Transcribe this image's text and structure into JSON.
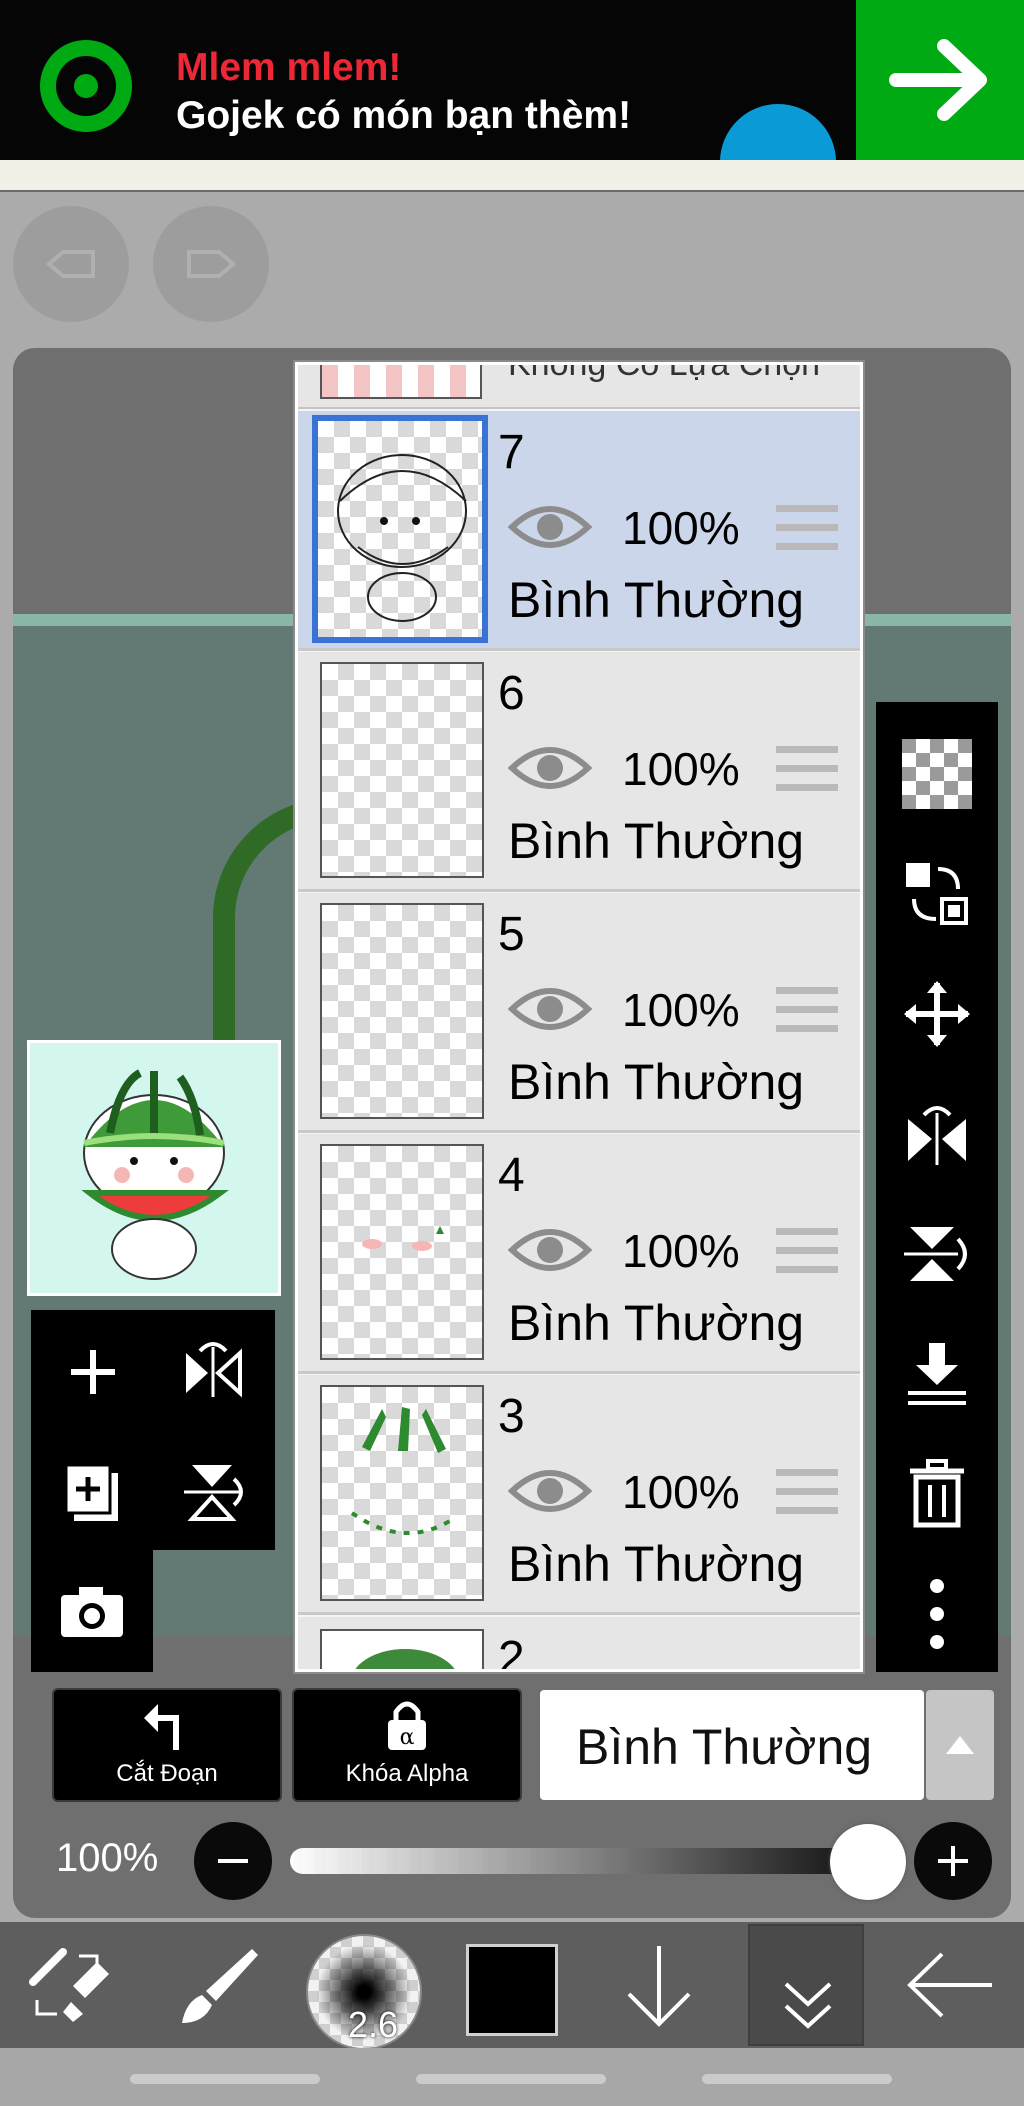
{
  "ad": {
    "title": "Mlem mlem!",
    "subtitle": "Gojek có món bạn thèm!",
    "brand_color": "#00aa13",
    "title_color": "#ee2737"
  },
  "top_controls": {
    "undo_icon": "undo-icon",
    "redo_icon": "redo-icon"
  },
  "layers": {
    "top_partial_label": "Không Có Lựa Chọn",
    "items": [
      {
        "number": "7",
        "opacity": "100%",
        "blend": "Bình Thường",
        "selected": true
      },
      {
        "number": "6",
        "opacity": "100%",
        "blend": "Bình Thường",
        "selected": false
      },
      {
        "number": "5",
        "opacity": "100%",
        "blend": "Bình Thường",
        "selected": false
      },
      {
        "number": "4",
        "opacity": "100%",
        "blend": "Bình Thường",
        "selected": false
      },
      {
        "number": "3",
        "opacity": "100%",
        "blend": "Bình Thường",
        "selected": false
      }
    ],
    "bottom_partial_number": "2",
    "selected_color": "#3a73d6"
  },
  "controls": {
    "clipping_label": "Cắt Đoạn",
    "alpha_lock_label": "Khóa Alpha",
    "blend_mode": "Bình Thường",
    "opacity_label": "100%",
    "opacity_value": 1.0
  },
  "toolbar": {
    "brush_size": "2.6",
    "current_color": "#000000"
  }
}
